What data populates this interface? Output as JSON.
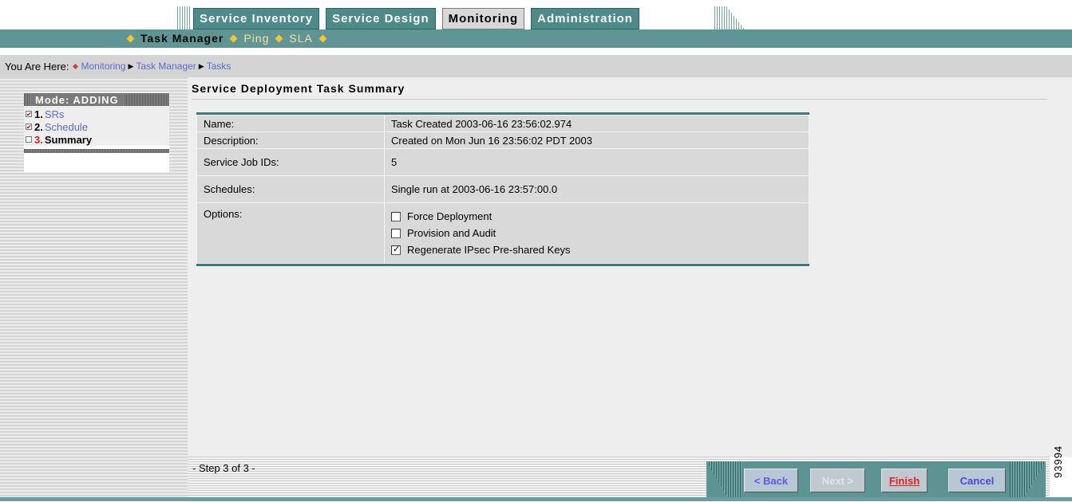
{
  "tabs": [
    {
      "label": "Service Inventory",
      "active": false
    },
    {
      "label": "Service Design",
      "active": false
    },
    {
      "label": "Monitoring",
      "active": true
    },
    {
      "label": "Administration",
      "active": false
    }
  ],
  "subnav": {
    "items": [
      {
        "label": "Task Manager",
        "current": true
      },
      {
        "label": "Ping",
        "current": false
      },
      {
        "label": "SLA",
        "current": false
      }
    ]
  },
  "breadcrumb": {
    "prefix": "You Are Here:",
    "items": [
      "Monitoring",
      "Task Manager",
      "Tasks"
    ]
  },
  "sidebar": {
    "mode_label": "Mode: ADDING",
    "steps": [
      {
        "num": "1.",
        "label": "SRs",
        "checked": true
      },
      {
        "num": "2.",
        "label": "Schedule",
        "checked": true
      },
      {
        "num": "3.",
        "label": "Summary",
        "checked": false
      }
    ]
  },
  "page": {
    "title": "Service Deployment Task Summary"
  },
  "summary": {
    "name_label": "Name:",
    "name_value": "Task Created 2003-06-16 23:56:02.974",
    "description_label": "Description:",
    "description_value": "Created on Mon Jun 16 23:56:02 PDT 2003",
    "job_ids_label": "Service Job IDs:",
    "job_ids_value": "5",
    "schedules_label": "Schedules:",
    "schedules_value": "Single run at 2003-06-16 23:57:00.0",
    "options_label": "Options:",
    "options": [
      {
        "label": "Force Deployment",
        "checked": false
      },
      {
        "label": "Provision and Audit",
        "checked": false
      },
      {
        "label": "Regenerate IPsec Pre-shared Keys",
        "checked": true
      }
    ]
  },
  "footer": {
    "step_text": "- Step 3 of 3 -",
    "back_label": "< Back",
    "next_label": "Next >",
    "finish_label": "Finish",
    "cancel_label": "Cancel"
  },
  "figure_id": "93994",
  "colors": {
    "teal": "#5f9595",
    "tab_bg": "#4f8a8a",
    "link": "#5a6bd0",
    "finish_red": "#e22222"
  }
}
